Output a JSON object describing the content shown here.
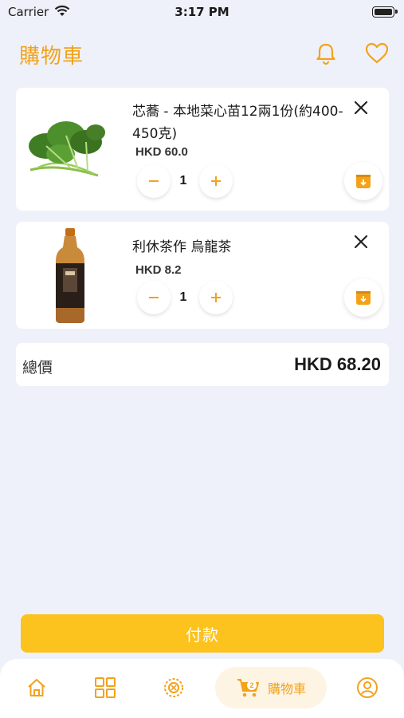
{
  "status_bar": {
    "carrier": "Carrier",
    "time": "3:17 PM"
  },
  "header": {
    "title": "購物車",
    "icons": [
      "bell-icon",
      "heart-icon"
    ]
  },
  "cart": {
    "items": [
      {
        "name": "芯蕎 - 本地菜心苗12兩1份(約400-450克)",
        "price": "HKD 60.0",
        "quantity": "1"
      },
      {
        "name": "利休茶作 烏龍茶",
        "price": "HKD 8.2",
        "quantity": "1"
      }
    ],
    "total_label": "總價",
    "total_value": "HKD 68.20"
  },
  "pay_button": {
    "label": "付款"
  },
  "tab_bar": {
    "tabs": [
      {
        "icon": "home-icon"
      },
      {
        "icon": "grid-icon"
      },
      {
        "icon": "scan-icon"
      },
      {
        "icon": "cart-icon",
        "label": "購物車",
        "badge": "2",
        "active": true
      },
      {
        "icon": "user-icon"
      }
    ]
  },
  "colors": {
    "accent": "#f3a21a",
    "pay": "#fcc21d",
    "background": "#eff1fa"
  }
}
